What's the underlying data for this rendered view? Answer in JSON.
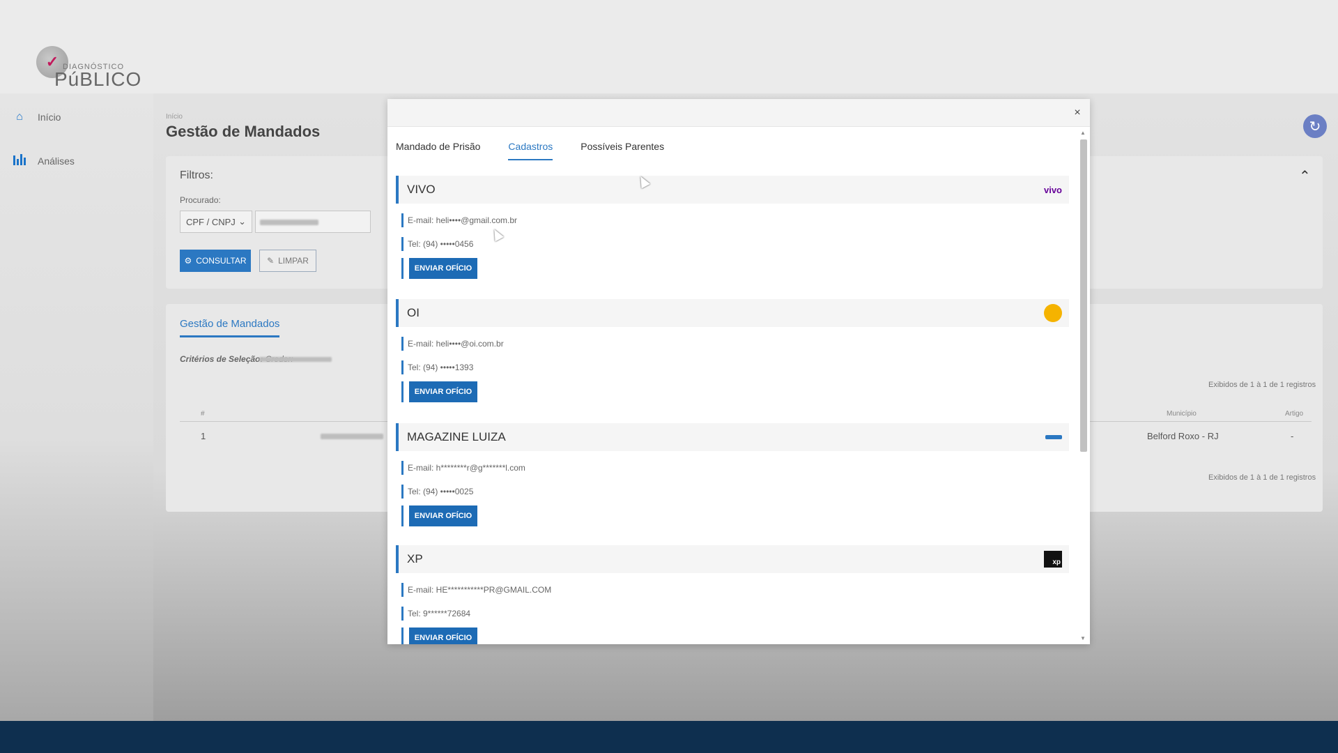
{
  "app": {
    "logo_small": "DIAGNÓSTICO",
    "logo_big": "PúBLICO"
  },
  "sidebar": {
    "items": [
      {
        "label": "Início",
        "icon": "home-icon"
      },
      {
        "label": "Análises",
        "icon": "bar-chart-icon"
      }
    ]
  },
  "page": {
    "breadcrumb": "Início",
    "title": "Gestão de Mandados"
  },
  "filters": {
    "label": "Filtros:",
    "procurado_label": "Procurado:",
    "select_value": "CPF / CNPJ",
    "consultar_label": "CONSULTAR",
    "limpar_label": "LIMPAR"
  },
  "results": {
    "tab_label": "Gestão de Mandados",
    "criterios_label": "Critérios de Seleção:",
    "criterios_value": "Credor:",
    "exibidos_top": "Exibidos de 1 à 1 de 1 registros",
    "exibidos_bottom": "Exibidos de 1 à 1 de 1 registros",
    "headers": {
      "index": "#",
      "municipio": "Município",
      "artigo": "Artigo"
    },
    "row": {
      "index": "1",
      "municipio": "Belford Roxo - RJ",
      "artigo": "-"
    }
  },
  "modal": {
    "close_label": "×",
    "tabs": [
      {
        "label": "Mandado de Prisão",
        "active": false
      },
      {
        "label": "Cadastros",
        "active": true
      },
      {
        "label": "Possíveis Parentes",
        "active": false
      }
    ],
    "cards": [
      {
        "title": "VIVO",
        "logo": "vivo",
        "email": "E-mail: heli••••@gmail.com.br",
        "tel": "Tel: (94) •••••0456",
        "button": "ENVIAR OFÍCIO"
      },
      {
        "title": "OI",
        "logo": "oi",
        "email": "E-mail: heli••••@oi.com.br",
        "tel": "Tel: (94) •••••1393",
        "button": "ENVIAR OFÍCIO"
      },
      {
        "title": "MAGAZINE LUIZA",
        "logo": "magalu",
        "email": "E-mail: h********r@g*******l.com",
        "tel": "Tel: (94) •••••0025",
        "button": "ENVIAR OFÍCIO"
      },
      {
        "title": "XP",
        "logo": "xp",
        "email": "E-mail: HE***********PR@GMAIL.COM",
        "tel": "Tel: 9******72684",
        "button": "ENVIAR OFÍCIO"
      }
    ],
    "logo_texts": {
      "vivo": "vivo",
      "xp": "xp"
    }
  },
  "colors": {
    "accent": "#2b78c2",
    "button": "#1d6bb5",
    "vivo": "#660099",
    "oi": "#f5b300",
    "footer": "#0e2f4f"
  }
}
